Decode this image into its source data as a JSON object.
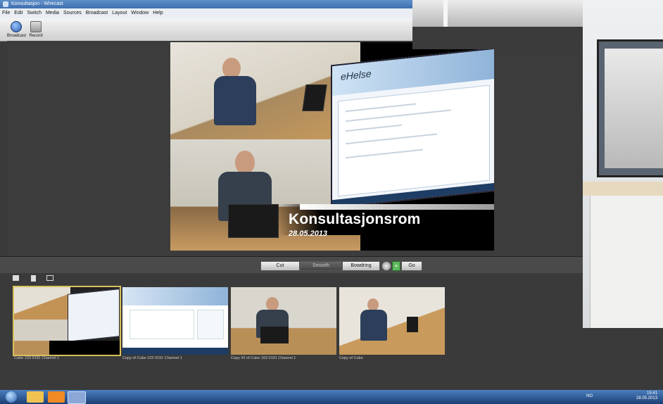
{
  "window": {
    "title": "Konsultasjon - Wirecast"
  },
  "menu": [
    "File",
    "Edit",
    "Switch",
    "Media",
    "Sources",
    "Broadcast",
    "Layout",
    "Window",
    "Help"
  ],
  "toolbar": {
    "broadcast_label": "Broadcast",
    "record_label": "Record"
  },
  "preview": {
    "lower_third_title": "Konsultasjonsrom",
    "lower_third_date": "28.05.2013",
    "screen_logo": "eHelse"
  },
  "transitions": {
    "cut": "Cut",
    "smooth": "Smooth",
    "bowdring": "Bowdring",
    "go": "Go"
  },
  "shots": [
    {
      "label": "Cube 103 0191 Channel 1",
      "selected": true
    },
    {
      "label": "Copy of Cube 103 0191 Channel 1",
      "selected": false
    },
    {
      "label": "Copy #2 of Cube 103 0191 Channel 1",
      "selected": false
    },
    {
      "label": "Copy of Cube",
      "selected": false
    }
  ],
  "taskbar": {
    "language": "NO",
    "time": "15:41",
    "date": "28.05.2013"
  },
  "colors": {
    "selected_shot_border": "#d8c05a",
    "title_bar": "#3f6fae",
    "taskbar": "#1d3f74"
  }
}
